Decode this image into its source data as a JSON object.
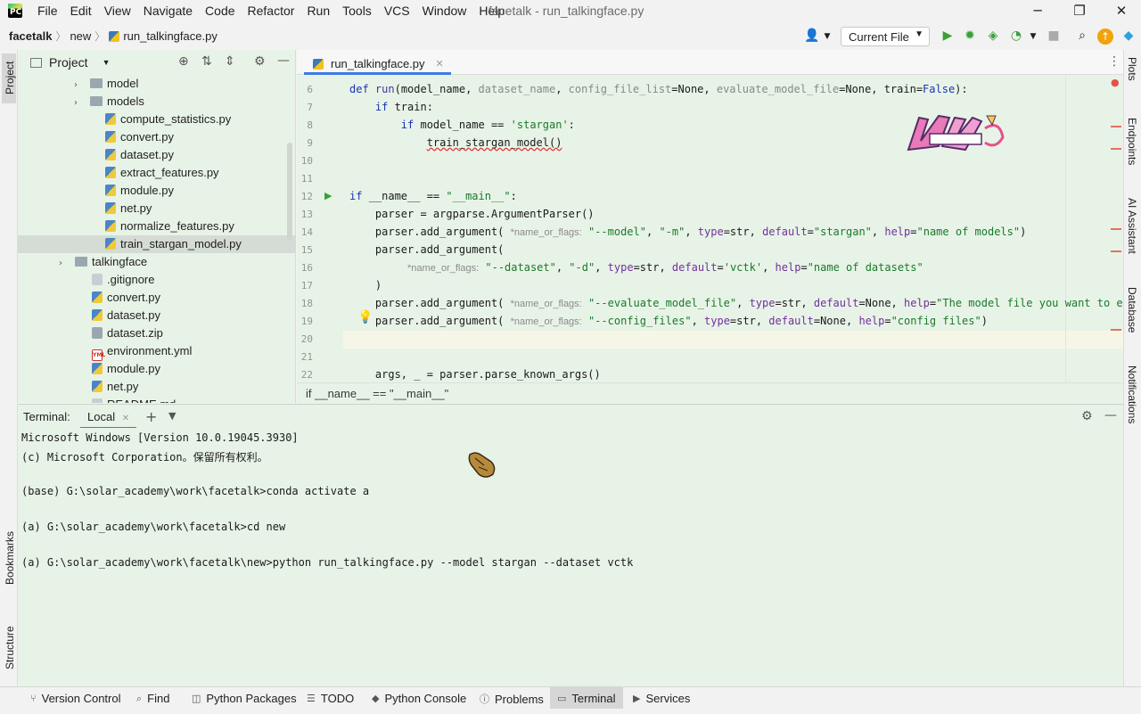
{
  "window": {
    "title": "facetalk - run_talkingface.py",
    "minimize_icon": "minimize-icon",
    "restore_icon": "restore-icon",
    "close_icon": "close-icon"
  },
  "menu": [
    "File",
    "Edit",
    "View",
    "Navigate",
    "Code",
    "Refactor",
    "Run",
    "Tools",
    "VCS",
    "Window",
    "Help"
  ],
  "nav": {
    "crumbs": [
      "facetalk",
      "new",
      "run_talkingface.py"
    ],
    "run_config": "Current File"
  },
  "project": {
    "title": "Project",
    "tree": [
      {
        "label": "model",
        "type": "folder",
        "indent": 1,
        "collapsed": true
      },
      {
        "label": "models",
        "type": "folder",
        "indent": 1,
        "collapsed": true
      },
      {
        "label": "compute_statistics.py",
        "type": "py",
        "indent": 2
      },
      {
        "label": "convert.py",
        "type": "py",
        "indent": 2
      },
      {
        "label": "dataset.py",
        "type": "py",
        "indent": 2
      },
      {
        "label": "extract_features.py",
        "type": "py",
        "indent": 2
      },
      {
        "label": "module.py",
        "type": "py",
        "indent": 2
      },
      {
        "label": "net.py",
        "type": "py",
        "indent": 2
      },
      {
        "label": "normalize_features.py",
        "type": "py",
        "indent": 2
      },
      {
        "label": "train_stargan_model.py",
        "type": "py",
        "indent": 2,
        "selected": true
      },
      {
        "label": "talkingface",
        "type": "folder",
        "indent": 0,
        "collapsed": true
      },
      {
        "label": ".gitignore",
        "type": "txt",
        "indent": 1
      },
      {
        "label": "convert.py",
        "type": "py",
        "indent": 1
      },
      {
        "label": "dataset.py",
        "type": "py",
        "indent": 1
      },
      {
        "label": "dataset.zip",
        "type": "zip",
        "indent": 1
      },
      {
        "label": "environment.yml",
        "type": "yml",
        "indent": 1
      },
      {
        "label": "module.py",
        "type": "py",
        "indent": 1
      },
      {
        "label": "net.py",
        "type": "py",
        "indent": 1
      },
      {
        "label": "README.md",
        "type": "txt",
        "indent": 1
      }
    ]
  },
  "editor": {
    "tab": "run_talkingface.py",
    "lines": [
      "6",
      "7",
      "8",
      "9",
      "10",
      "11",
      "12",
      "13",
      "14",
      "15",
      "16",
      "17",
      "18",
      "19",
      "20",
      "21",
      "22"
    ],
    "breadcrumb": "if __name__ == \"__main__\"",
    "c6a": "def ",
    "c6b": "run",
    "c6c": "(model_name, ",
    "c6d": "dataset_name",
    "c6e": ", ",
    "c6f": "config_file_list",
    "c6g": "=None, ",
    "c6h": "evaluate_model_file",
    "c6i": "=None, train=",
    "c6j": "False",
    "c6k": "):",
    "c7a": "    if ",
    "c7b": "train:",
    "c8a": "        if ",
    "c8b": "model_name == ",
    "c8c": "'stargan'",
    "c8d": ":",
    "c9a": "            ",
    "c9b": "train_stargan_model()",
    "c12a": "if ",
    "c12b": "__name__ == ",
    "c12c": "\"__main__\"",
    "c12d": ":",
    "c13": "    parser = argparse.ArgumentParser()",
    "c14a": "    parser.add_argument( ",
    "c14h": "*name_or_flags:",
    "c14b": " \"--model\"",
    "c14c": ", ",
    "c14d": "\"-m\"",
    "c14e": ", ",
    "c14f": "type",
    "c14g": "=str, ",
    "c14i": "default",
    "c14j": "=",
    "c14k": "\"stargan\"",
    "c14l": ", ",
    "c14m": "help",
    "c14n": "=",
    "c14o": "\"name of models\"",
    "c14p": ")",
    "c15": "    parser.add_argument(",
    "c16a": "         ",
    "c16h": "*name_or_flags:",
    "c16b": " \"--dataset\"",
    "c16c": ", ",
    "c16d": "\"-d\"",
    "c16e": ", ",
    "c16f": "type",
    "c16g": "=str, ",
    "c16i": "default",
    "c16j": "=",
    "c16k": "'vctk'",
    "c16l": ", ",
    "c16m": "help",
    "c16n": "=",
    "c16o": "\"name of datasets\"",
    "c17": "    )",
    "c18a": "    parser.add_argument( ",
    "c18h": "*name_or_flags:",
    "c18b": " \"--evaluate_model_file\"",
    "c18c": ", ",
    "c18f": "type",
    "c18g": "=str, ",
    "c18i": "default",
    "c18j": "=None, ",
    "c18m": "help",
    "c18n": "=",
    "c18o": "\"The model file you want to evaluate\"",
    "c18p": ")",
    "c19a": "    parser.add_argument( ",
    "c19h": "*name_or_flags:",
    "c19b": " \"--config_files\"",
    "c19c": ", ",
    "c19f": "type",
    "c19g": "=str, ",
    "c19i": "default",
    "c19j": "=None, ",
    "c19m": "help",
    "c19n": "=",
    "c19o": "\"config files\"",
    "c19p": ")",
    "c22": "    args, _ = parser.parse_known_args()"
  },
  "terminal": {
    "label": "Terminal:",
    "tab": "Local",
    "lines": [
      "Microsoft Windows [Version 10.0.19045.3930]",
      "(c) Microsoft Corporation。保留所有权利。",
      "",
      "(base) G:\\solar_academy\\work\\facetalk>conda activate a",
      "",
      "(a) G:\\solar_academy\\work\\facetalk>cd new",
      "",
      "(a) G:\\solar_academy\\work\\facetalk\\new>python run_talkingface.py --model stargan --dataset vctk"
    ]
  },
  "left_stripe": [
    "Project",
    "Bookmarks",
    "Structure"
  ],
  "right_stripe": [
    "Plots",
    "Endpoints",
    "AI Assistant",
    "Database",
    "Notifications"
  ],
  "bottom_tabs": [
    {
      "label": "Version Control",
      "icon": "branch-icon"
    },
    {
      "label": "Find",
      "icon": "search-icon"
    },
    {
      "label": "Python Packages",
      "icon": "package-icon"
    },
    {
      "label": "TODO",
      "icon": "list-icon"
    },
    {
      "label": "Python Console",
      "icon": "python-icon"
    },
    {
      "label": "Problems",
      "icon": "warning-icon"
    },
    {
      "label": "Terminal",
      "icon": "terminal-icon",
      "active": true
    },
    {
      "label": "Services",
      "icon": "play-icon"
    }
  ],
  "colors": {
    "panel_bg": "#e8f3e7",
    "accent": "#3d7ae6",
    "keyword": "#1a33b5",
    "string": "#197a2a"
  }
}
